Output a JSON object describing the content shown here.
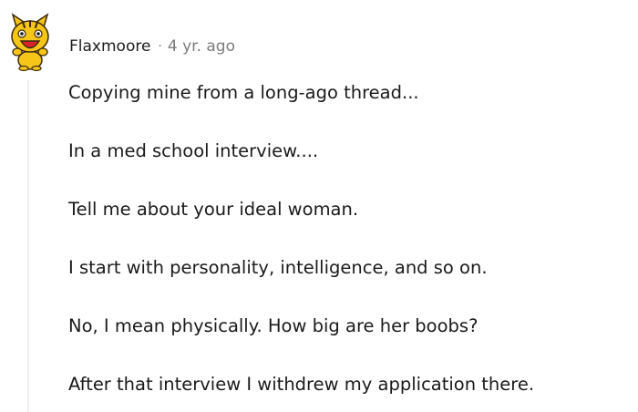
{
  "comment": {
    "author": "Flaxmoore",
    "separator": "·",
    "timestamp": "4 yr. ago",
    "avatar_icon": "snoo-avatar-icon",
    "paragraphs": [
      "Copying mine from a long-ago thread...",
      "In a med school interview....",
      "Tell me about your ideal woman.",
      "I start with personality, intelligence, and so on.",
      "No, I mean physically. How big are her boobs?",
      "After that interview I withdrew my application there."
    ]
  },
  "colors": {
    "text": "#1a1a1b",
    "meta": "#7c7c7c",
    "thread_line": "#edeff1",
    "avatar_yellow": "#f5c518",
    "avatar_red": "#d9252a"
  }
}
